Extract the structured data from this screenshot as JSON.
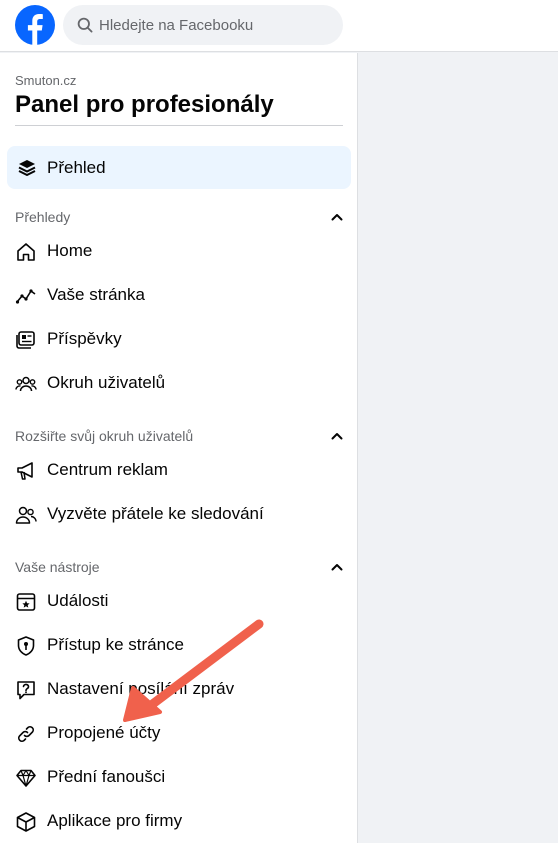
{
  "header": {
    "logo_icon": "facebook-logo-icon",
    "search_placeholder": "Hledejte na Facebooku",
    "brand_color": "#0866ff"
  },
  "sidebar": {
    "page_name": "Smuton.cz",
    "title": "Panel pro profesionály",
    "overview_label": "Přehled",
    "sections": [
      {
        "heading": "Přehledy",
        "items": [
          {
            "label": "Home",
            "icon": "home-icon"
          },
          {
            "label": "Vaše stránka",
            "icon": "trend-line-icon"
          },
          {
            "label": "Příspěvky",
            "icon": "posts-icon"
          },
          {
            "label": "Okruh uživatelů",
            "icon": "audience-icon"
          }
        ]
      },
      {
        "heading": "Rozšiřte svůj okruh uživatelů",
        "items": [
          {
            "label": "Centrum reklam",
            "icon": "megaphone-icon"
          },
          {
            "label": "Vyzvěte přátele ke sledování",
            "icon": "invite-friends-icon"
          }
        ]
      },
      {
        "heading": "Vaše nástroje",
        "items": [
          {
            "label": "Události",
            "icon": "calendar-star-icon"
          },
          {
            "label": "Přístup ke stránce",
            "icon": "shield-key-icon"
          },
          {
            "label": "Nastavení posílání zpráv",
            "icon": "message-question-icon"
          },
          {
            "label": "Propojené účty",
            "icon": "link-icon"
          },
          {
            "label": "Přední fanoušci",
            "icon": "diamond-icon"
          },
          {
            "label": "Aplikace pro firmy",
            "icon": "box-icon"
          }
        ]
      }
    ]
  },
  "annotation": {
    "arrow_color": "#f0614c",
    "arrow_target": "Propojené účty"
  }
}
